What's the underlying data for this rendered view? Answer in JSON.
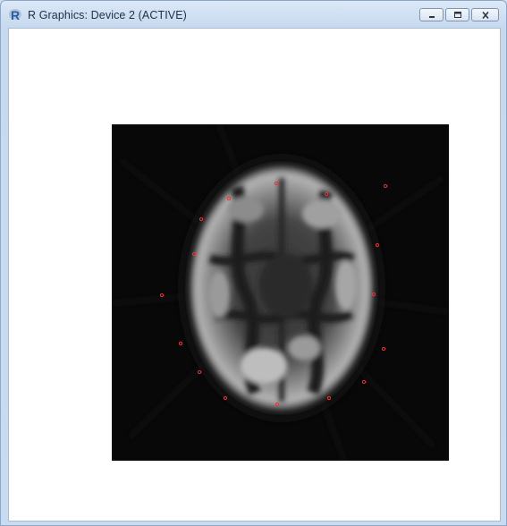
{
  "window": {
    "title": "R Graphics: Device 2 (ACTIVE)",
    "app_icon_letter": "R"
  },
  "caption_buttons": {
    "minimize": "minimize-icon",
    "maximize": "maximize-icon",
    "close": "close-icon"
  },
  "image": {
    "kind": "grayscale brain MRI slice",
    "marker_color": "#ff2a2a",
    "marker_count": 16
  }
}
